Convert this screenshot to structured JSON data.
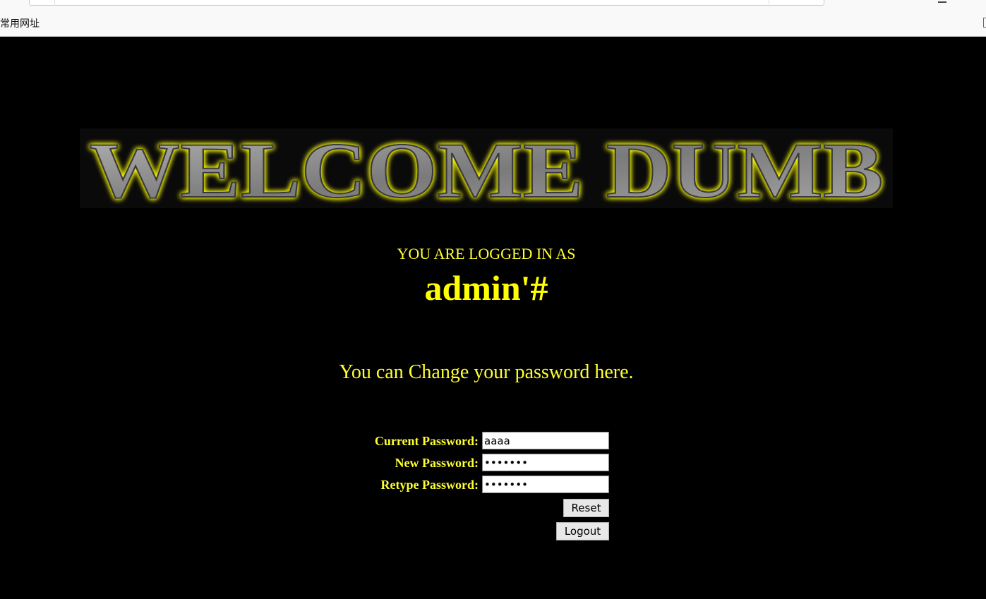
{
  "browser": {
    "bookmarks_bar": {
      "items": [
        {
          "label": "常用网址"
        }
      ]
    }
  },
  "page": {
    "banner_text": "WELCOME DUMB",
    "logged_in_label": "YOU ARE LOGGED IN AS",
    "username": "admin'#",
    "change_message": "You can Change your password here.",
    "form": {
      "current_password": {
        "label": "Current Password:",
        "value": "aaaa"
      },
      "new_password": {
        "label": "New Password:",
        "value": "•••••••"
      },
      "retype_password": {
        "label": "Retype Password:",
        "value": "•••••••"
      },
      "reset_label": "Reset",
      "logout_label": "Logout"
    }
  },
  "colors": {
    "background": "#000000",
    "text_accent": "#ffff33",
    "banner_glow": "#ffff00",
    "banner_metal": "#8c8c8c"
  }
}
